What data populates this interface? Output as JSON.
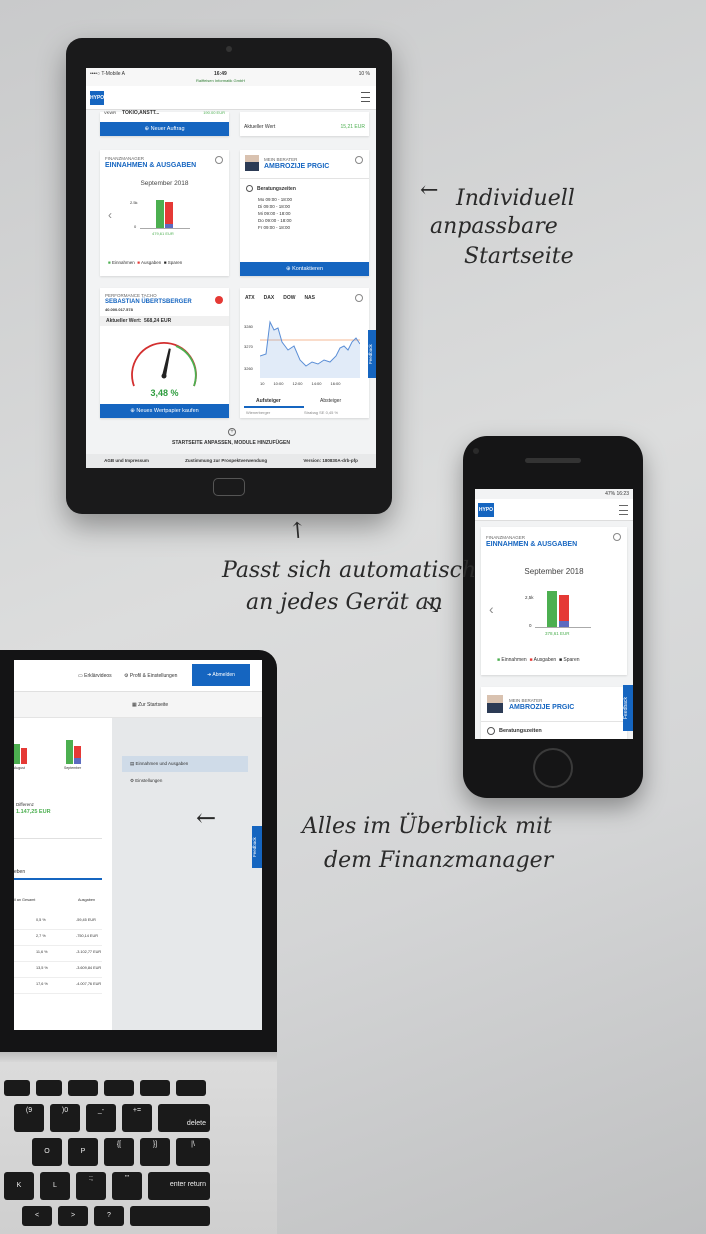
{
  "annotations": {
    "tablet_note": [
      "Individuell",
      "anpassbare",
      "Startseite"
    ],
    "phone_note": [
      "Passt sich automatisch",
      "an jedes Gerät an"
    ],
    "laptop_note": [
      "Alles im Überblick mit",
      "dem Finanzmanager"
    ]
  },
  "brand": {
    "logo": "HYPO",
    "accent": "#1565c0",
    "green": "#4caf50",
    "red": "#e53935"
  },
  "tablet": {
    "status": {
      "carrier": "••••○ T-Mobile A",
      "time": "16:49",
      "battery": "10 %",
      "host": "Raiffeisen Informatik GmbH"
    },
    "top_left": {
      "row_label": "VKWR",
      "row_value": "TOKIO,ANSTT...",
      "row_amount": "190.00 EUR",
      "button": "Neuer Auftrag"
    },
    "top_right": {
      "label": "Aktueller Wert",
      "value": "15,21 EUR"
    },
    "finance": {
      "kicker": "FINANZMANAGER",
      "title": "EINNAHMEN & AUSGABEN",
      "month": "September 2018",
      "y_top": "2.5k",
      "y_zero": "0",
      "x_label": "479,61 EUR",
      "legend": [
        "Einnahmen",
        "Ausgaben",
        "Sparen"
      ]
    },
    "advisor": {
      "kicker": "MEIN BERATER",
      "name": "AMBROZIJE PRGIC",
      "hours_title": "Beratungszeiten",
      "hours": [
        {
          "day": "Mo",
          "time": "09:00 - 18:00"
        },
        {
          "day": "Di",
          "time": "09:00 - 18:00"
        },
        {
          "day": "Mi",
          "time": "09:00 - 18:00"
        },
        {
          "day": "Do",
          "time": "09:00 - 18:00"
        },
        {
          "day": "Fr",
          "time": "09:00 - 18:00"
        }
      ],
      "button": "Kontaktieren"
    },
    "performance": {
      "kicker": "PERFORMANCE TACHO",
      "name": "SEBASTIAN ÜBERTSBERGER",
      "account": "40.000.017.578",
      "value_label": "Aktueller Wert:",
      "value": "568,24 EUR",
      "gauge": "3,48 %",
      "gauge_fraction": 0.55,
      "button": "Neues Wertpapier kaufen"
    },
    "market": {
      "tabs": [
        "ATX",
        "DAX",
        "DOW",
        "NAS"
      ],
      "y_ticks": [
        "3280",
        "3270",
        "3260"
      ],
      "x_ticks": [
        "10",
        "10:00",
        "12:00",
        "14:00",
        "16:00"
      ],
      "subtabs": [
        "Aufsteiger",
        "Absteiger"
      ],
      "row": [
        "Wienerberger",
        "Strabag SE",
        "0,45 %"
      ]
    },
    "feedback": "Feedback",
    "customize": "STARTSEITE ANPASSEN, MODULE HINZUFÜGEN",
    "footer": [
      "AGB und Impressum",
      "Zustimmung zur Prospektverwendung",
      "Version: 180830A-drb-pfp"
    ]
  },
  "phone": {
    "status": "47% 16:23",
    "logo": "HYPO",
    "finance": {
      "kicker": "FINANZMANAGER",
      "title": "EINNAHMEN & AUSGABEN",
      "month": "September 2018",
      "y_top": "2,5k",
      "y_zero": "0",
      "x_label": "378,61 EUR",
      "legend": [
        "Einnahmen",
        "Ausgaben",
        "Sparen"
      ]
    },
    "advisor": {
      "kicker": "MEIN BERATER",
      "name": "AMBROZIJE PRGIC",
      "hours_title": "Beratungszeiten"
    },
    "feedback": "Feedback"
  },
  "laptop": {
    "nav": [
      "Erklärvideos",
      "Profil & Einstellungen",
      "Abmelden"
    ],
    "home": "Zur Startseite",
    "menu": [
      "Einnahmen und Ausgaben",
      "Einstellungen"
    ],
    "bar_labels": [
      "August",
      "September"
    ],
    "difference": {
      "label": "Differenz",
      "value": "1.147,25 EUR"
    },
    "tab": "eben",
    "table_headers": [
      "il an Gesamt",
      "Ausgaben"
    ],
    "rows": [
      [
        "0,5 %",
        "-59,45 EUR"
      ],
      [
        "2,7 %",
        "-750,14 EUR"
      ],
      [
        "11,6 %",
        "-3.102,77 EUR"
      ],
      [
        "13,5 %",
        "-3.609,84 EUR"
      ],
      [
        "17,6 %",
        "-4.007,76 EUR"
      ]
    ],
    "feedback": "Feedback"
  },
  "keyboard": {
    "row1": [
      "",
      "",
      "",
      "",
      "",
      ""
    ],
    "row2": [
      "(9",
      ")0",
      "_-",
      "+=",
      "delete"
    ],
    "row3": [
      "O",
      "P",
      "{[",
      "}]",
      "|\\"
    ],
    "row4": [
      "K",
      "L",
      ":;",
      "\"'",
      "enter return"
    ],
    "row5": [
      "<",
      ">",
      "?"
    ]
  }
}
